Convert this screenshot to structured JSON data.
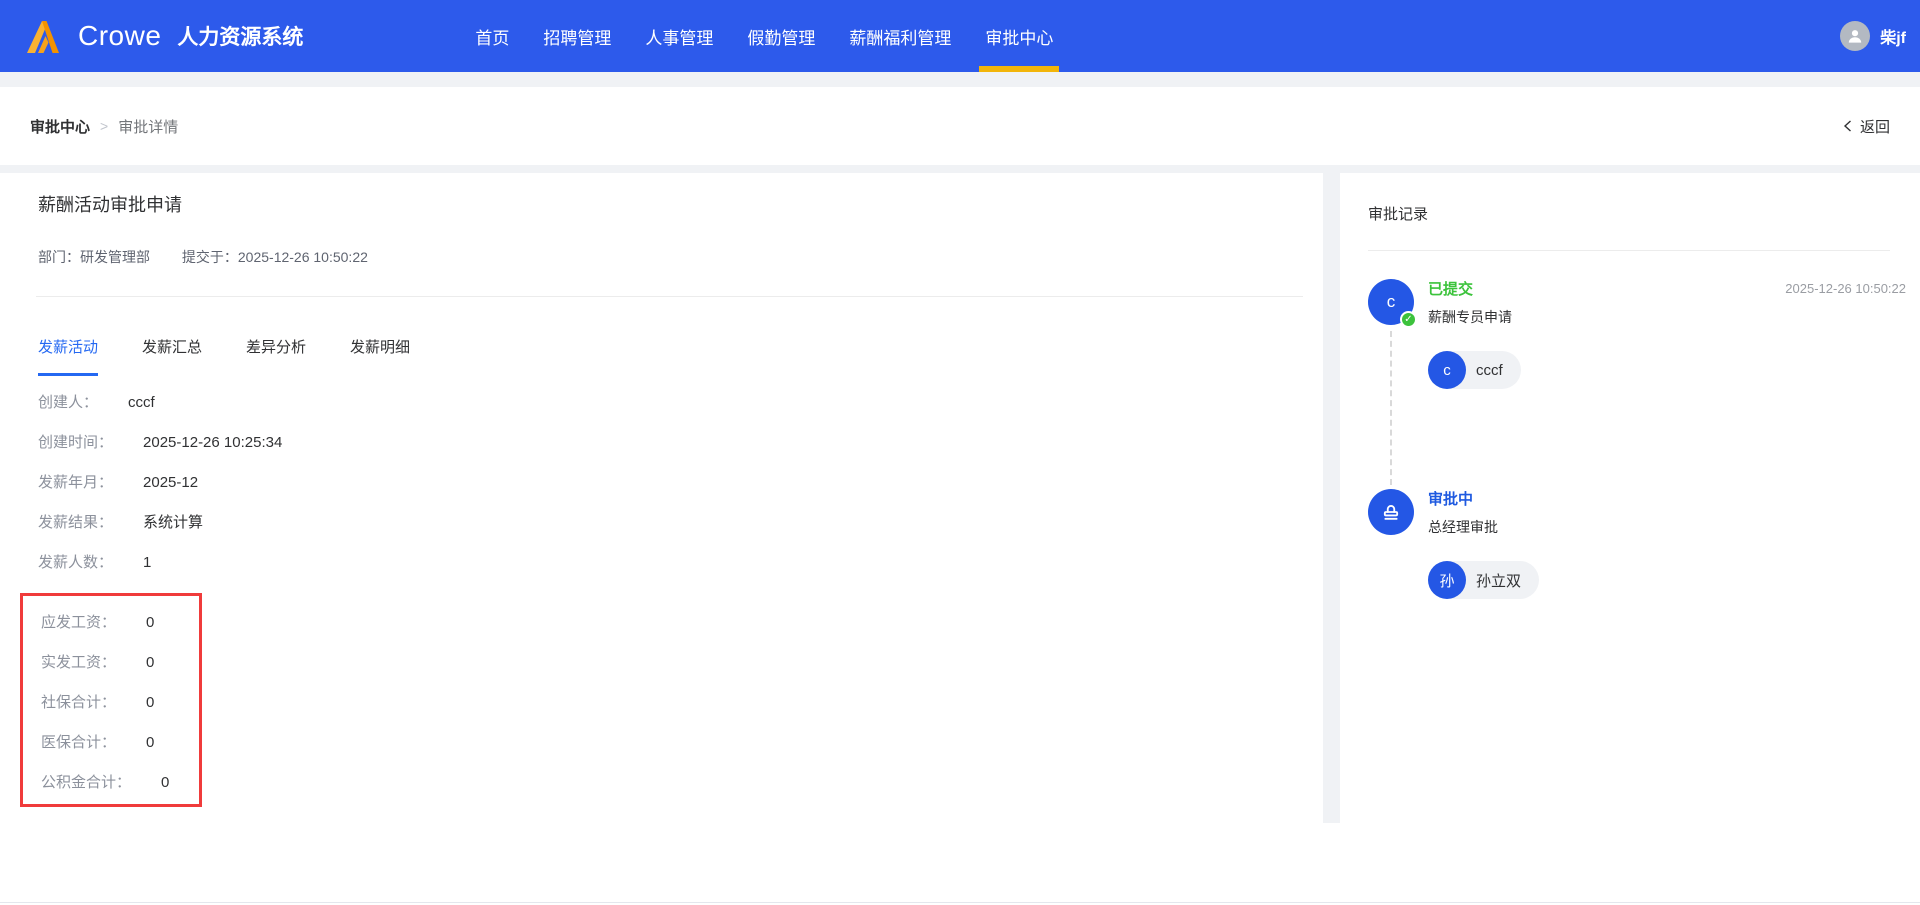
{
  "header": {
    "brand": {
      "word": "Crowe",
      "product": "人力资源系统",
      "logo_icon": "crowe-mountain-logo"
    },
    "nav": [
      {
        "label": "首页",
        "active": false
      },
      {
        "label": "招聘管理",
        "active": false
      },
      {
        "label": "人事管理",
        "active": false
      },
      {
        "label": "假勤管理",
        "active": false
      },
      {
        "label": "薪酬福利管理",
        "active": false
      },
      {
        "label": "审批中心",
        "active": true
      }
    ],
    "user": {
      "name": "柴jf",
      "avatar_icon": "user-icon"
    }
  },
  "breadcrumb": {
    "root": "审批中心",
    "separator": ">",
    "current": "审批详情",
    "back_label": "返回",
    "back_icon": "chevron-left-icon"
  },
  "detail": {
    "title": "薪酬活动审批申请",
    "meta": [
      {
        "label": "部门：",
        "value": "研发管理部"
      },
      {
        "label": "提交于：",
        "value": "2025-12-26 10:50:22"
      }
    ],
    "tabs": [
      {
        "label": "发薪活动",
        "active": true
      },
      {
        "label": "发薪汇总",
        "active": false
      },
      {
        "label": "差异分析",
        "active": false
      },
      {
        "label": "发薪明细",
        "active": false
      }
    ],
    "fields": [
      {
        "label": "创建人：",
        "value": "cccf",
        "highlighted": false
      },
      {
        "label": "创建时间：",
        "value": "2025-12-26 10:25:34",
        "highlighted": false
      },
      {
        "label": "发薪年月：",
        "value": "2025-12",
        "highlighted": false
      },
      {
        "label": "发薪结果：",
        "value": "系统计算",
        "highlighted": false
      },
      {
        "label": "发薪人数：",
        "value": "1",
        "highlighted": false
      },
      {
        "label": "应发工资：",
        "value": "0",
        "highlighted": true
      },
      {
        "label": "实发工资：",
        "value": "0",
        "highlighted": true
      },
      {
        "label": "社保合计：",
        "value": "0",
        "highlighted": true
      },
      {
        "label": "医保合计：",
        "value": "0",
        "highlighted": true
      },
      {
        "label": "公积金合计：",
        "value": "0",
        "highlighted": true
      }
    ]
  },
  "approval": {
    "title": "审批记录",
    "steps": [
      {
        "status": "已提交",
        "status_color": "#3cc33c",
        "desc": "薪酬专员申请",
        "time": "2025-12-26 10:50:22",
        "avatar_text": "c",
        "avatar_badge_icon": "check-badge-icon",
        "person": {
          "initial": "c",
          "name": "cccf"
        }
      },
      {
        "status": "审批中",
        "status_color": "#1f5ae0",
        "desc": "总经理审批",
        "avatar_icon": "stamp-icon",
        "person": {
          "initial": "孙",
          "name": "孙立双"
        }
      }
    ]
  },
  "colors": {
    "header_blue": "#2d5aeb",
    "nav_active_underline": "#f2b50a",
    "tab_active_blue": "#2468f2",
    "success_green": "#3cc33c",
    "pending_blue": "#1f5ae0",
    "highlight_red": "#f03b3b",
    "section_gap_gray": "#f0f2f5"
  }
}
